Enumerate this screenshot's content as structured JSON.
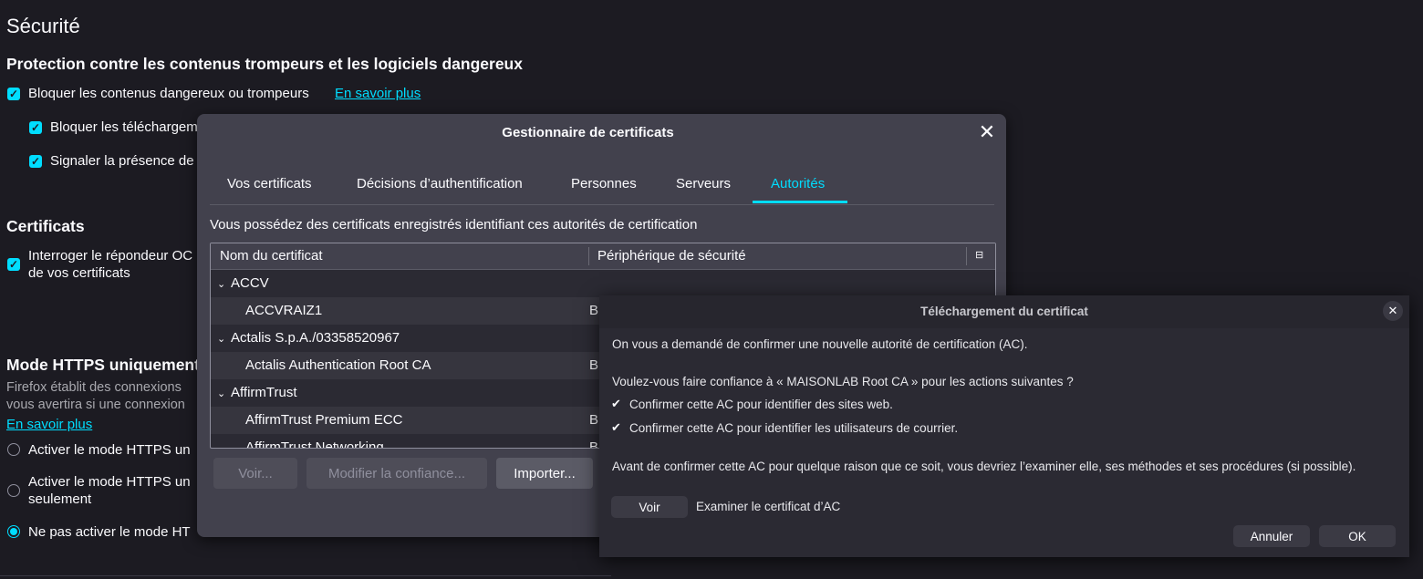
{
  "settings": {
    "section_title": "Sécurité",
    "protection_heading": "Protection contre les contenus trompeurs et les logiciels dangereux",
    "block_dangerous": "Bloquer les contenus dangereux ou trompeurs",
    "learn_more": "En savoir plus",
    "block_downloads": "Bloquer les téléchargem",
    "report_unwanted": "Signaler la présence de",
    "certificates_heading": "Certificats",
    "ocsp_line1": "Interroger le répondeur OC",
    "ocsp_line2": "de vos certificats",
    "https_heading": "Mode HTTPS uniquement",
    "https_desc1": "Firefox établit des connexions",
    "https_desc2": "vous avertira si une connexion",
    "https_learn_more": "En savoir plus",
    "https_opt1": "Activer le mode HTTPS un",
    "https_opt2_line1": "Activer le mode HTTPS un",
    "https_opt2_line2": "seulement",
    "https_opt3": "Ne pas activer le mode HT"
  },
  "cert_manager": {
    "title": "Gestionnaire de certificats",
    "tabs": [
      "Vos certificats",
      "Décisions d’authentification",
      "Personnes",
      "Serveurs",
      "Autorités"
    ],
    "active_tab": "Autorités",
    "description": "Vous possédez des certificats enregistrés identifiant ces autorités de certification",
    "columns": [
      "Nom du certificat",
      "Périphérique de sécurité"
    ],
    "rows": [
      {
        "name": "ACCV",
        "device": "",
        "group": true
      },
      {
        "name": "ACCVRAIZ1",
        "device": "B",
        "group": false
      },
      {
        "name": "Actalis S.p.A./03358520967",
        "device": "",
        "group": true
      },
      {
        "name": "Actalis Authentication Root CA",
        "device": "B",
        "group": false
      },
      {
        "name": "AffirmTrust",
        "device": "",
        "group": true
      },
      {
        "name": "AffirmTrust Premium ECC",
        "device": "B",
        "group": false
      },
      {
        "name": "AffirmTrust Networking",
        "device": "B",
        "group": false
      }
    ],
    "buttons": {
      "view": "Voir...",
      "edit_trust": "Modifier la confiance...",
      "import": "Importer..."
    }
  },
  "download_dialog": {
    "title": "Téléchargement du certificat",
    "intro": "On vous a demandé de confirmer une nouvelle autorité de certification (AC).",
    "question": "Voulez-vous faire confiance à « MAISONLAB Root CA » pour les actions suivantes ?",
    "option_websites": "Confirmer cette AC pour identifier des sites web.",
    "option_email": "Confirmer cette AC pour identifier les utilisateurs de courrier.",
    "warning": "Avant de confirmer cette AC pour quelque raison que ce soit, vous devriez l’examiner elle, ses méthodes et ses procédures (si possible).",
    "view_button": "Voir",
    "view_label": "Examiner le certificat d’AC",
    "cancel_button": "Annuler",
    "ok_button": "OK"
  },
  "colors": {
    "accent": "#00ddff",
    "background": "#1c1b22",
    "dialog": "#42414d"
  }
}
